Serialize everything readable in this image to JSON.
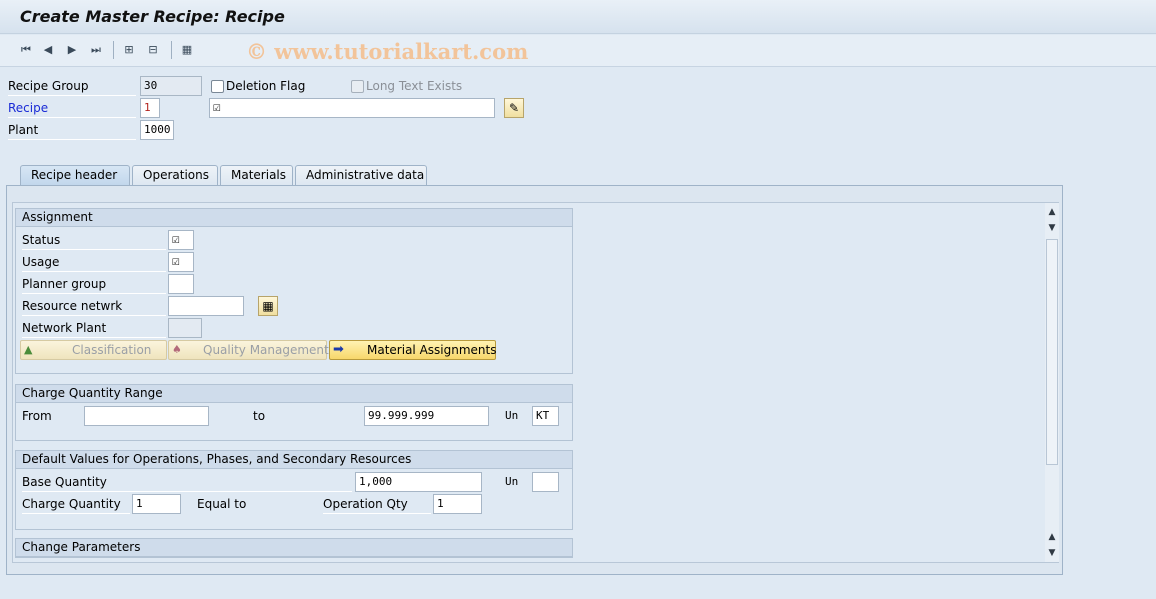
{
  "window": {
    "title": "Create Master Recipe: Recipe",
    "watermark": "© www.tutorialkart.com"
  },
  "toolbar": {
    "buttons": [
      "first-page-icon",
      "previous-page-icon",
      "next-page-icon",
      "last-page-icon",
      "hierarchy-icon",
      "structure-icon",
      "network-icon"
    ]
  },
  "header": {
    "recipe_group_label": "Recipe Group",
    "recipe_group_value": "30",
    "deletion_flag_label": "Deletion Flag",
    "long_text_label": "Long Text Exists",
    "recipe_label": "Recipe",
    "recipe_value": "1",
    "recipe_desc_value": "",
    "plant_label": "Plant",
    "plant_value": "1000"
  },
  "tabs": [
    {
      "label": "Recipe header",
      "active": true
    },
    {
      "label": "Operations",
      "active": false
    },
    {
      "label": "Materials",
      "active": false
    },
    {
      "label": "Administrative data",
      "active": false
    }
  ],
  "assignment": {
    "title": "Assignment",
    "status_label": "Status",
    "usage_label": "Usage",
    "planner_group_label": "Planner group",
    "planner_group_value": "",
    "resource_network_label": "Resource netwrk",
    "resource_network_value": "",
    "network_plant_label": "Network Plant",
    "network_plant_value": "",
    "classification_button": "Classification",
    "quality_button": "Quality Management",
    "material_button": "Material Assignments"
  },
  "charge_range": {
    "title": "Charge Quantity Range",
    "from_label": "From",
    "from_value": "",
    "to_label": "to",
    "to_value": "99.999.999",
    "unit_label": "Un",
    "unit_value": "KT"
  },
  "defaults": {
    "title": "Default Values for Operations, Phases, and Secondary Resources",
    "base_qty_label": "Base Quantity",
    "base_qty_value": "1,000",
    "unit_label": "Un",
    "unit_value": "",
    "charge_qty_label": "Charge Quantity",
    "charge_qty_value": "1",
    "equal_to_label": "Equal to",
    "operation_qty_label": "Operation Qty",
    "operation_qty_value": "1"
  },
  "change_params": {
    "title": "Change Parameters"
  },
  "colors": {
    "background": "#dfe9f3",
    "button_active": "#f7d76b",
    "link": "#1a2bd6"
  }
}
